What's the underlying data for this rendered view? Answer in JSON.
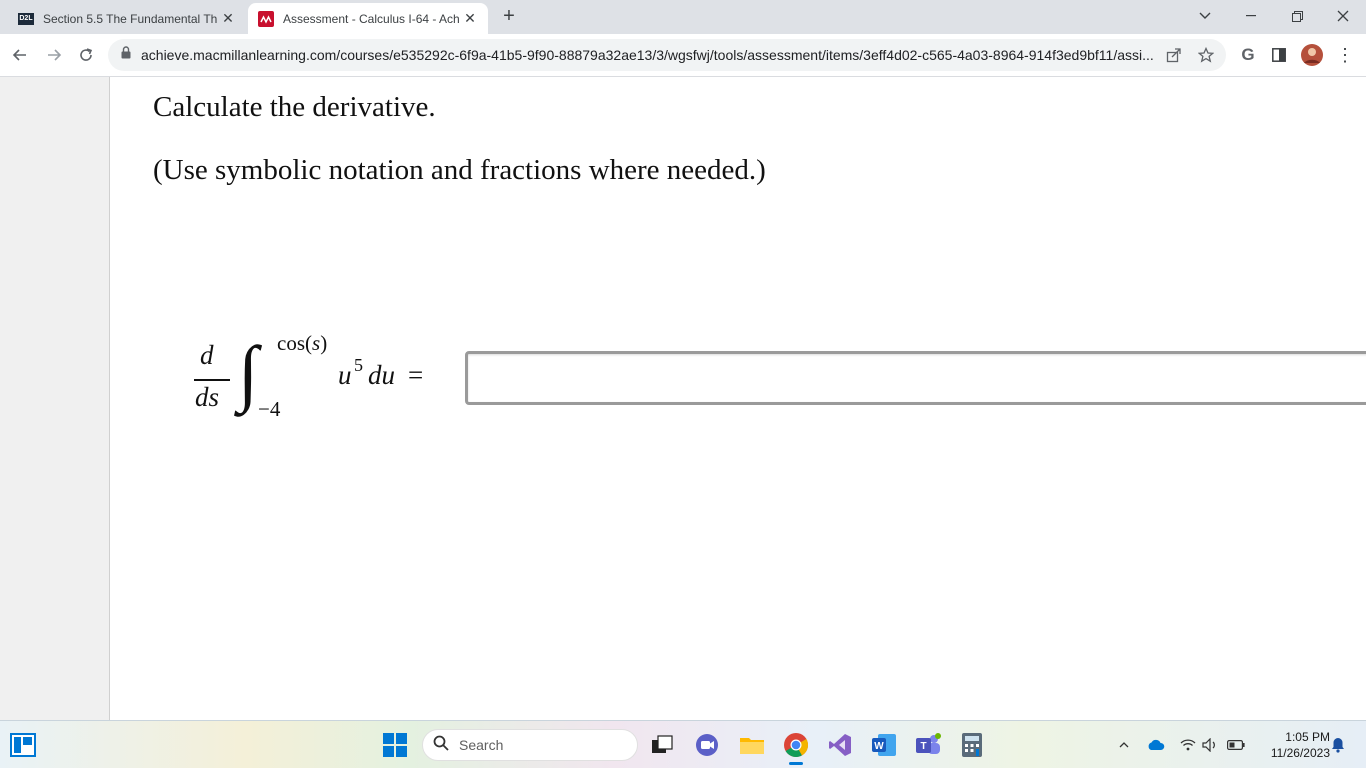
{
  "browser": {
    "tabs": [
      {
        "title": "Section 5.5 The Fundamental Th",
        "favicon": "d2l-icon",
        "favicon_text": "D2L",
        "active": false
      },
      {
        "title": "Assessment - Calculus I-64 - Ach",
        "favicon": "macmillan-icon",
        "active": true
      }
    ],
    "url": "achieve.macmillanlearning.com/courses/e535292c-6f9a-41b5-9f90-88879a32ae13/3/wgsfwj/tools/assessment/items/3eff4d02-c565-4a03-8964-914f3ed9bf11/assi..."
  },
  "question": {
    "prompt": "Calculate the derivative.",
    "instruction": "(Use symbolic notation and fractions where needed.)",
    "math": {
      "numerator": "d",
      "denominator": "ds",
      "integral_sign": "∫",
      "upper_limit_fn": "cos(",
      "upper_limit_var": "s",
      "upper_limit_close": ")",
      "lower_limit": "−4",
      "integrand_base": "u",
      "integrand_exponent": "5",
      "differential": "du",
      "equals": "="
    },
    "answer_value": ""
  },
  "taskbar": {
    "search_placeholder": "Search",
    "time": "1:05 PM",
    "date": "11/26/2023"
  },
  "colors": {
    "tabstrip_bg": "#dee1e6",
    "omnibox_bg": "#f1f3f4",
    "macmillan_red": "#c8102e",
    "chrome_green": "#34a853",
    "windows_blue": "#0078d4"
  }
}
